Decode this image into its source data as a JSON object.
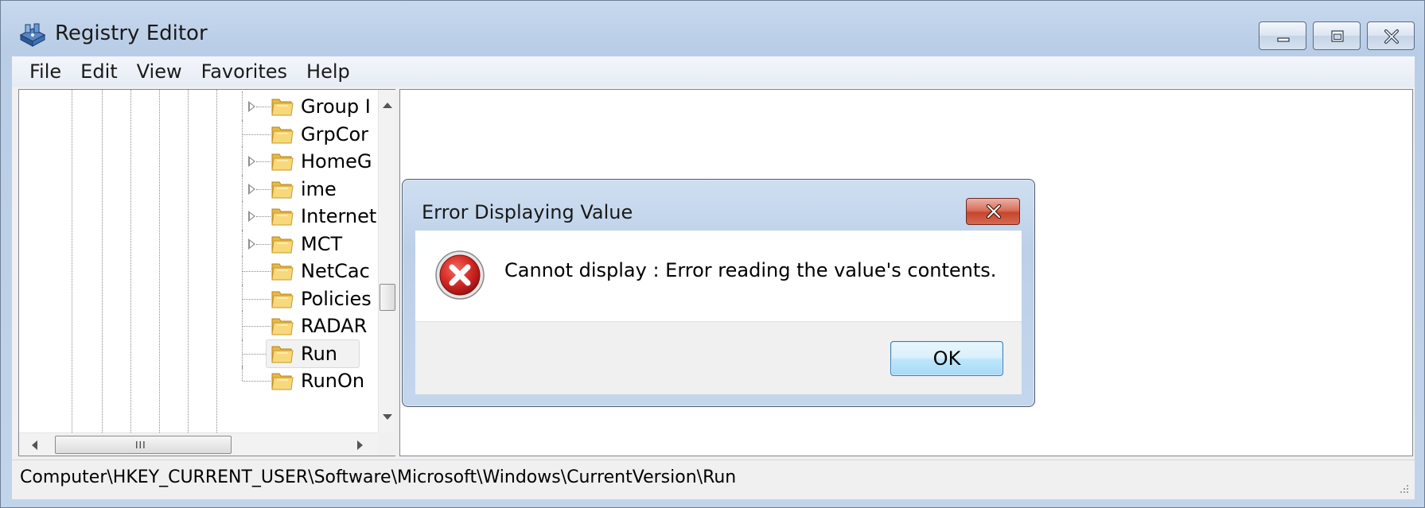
{
  "window": {
    "title": "Registry Editor",
    "icon": "registry-editor-icon",
    "controls": [
      "minimize",
      "maximize",
      "close"
    ]
  },
  "menu": {
    "items": [
      "File",
      "Edit",
      "View",
      "Favorites",
      "Help"
    ]
  },
  "tree": {
    "nodes": [
      {
        "label": "Group I",
        "expandable": true
      },
      {
        "label": "GrpCor",
        "expandable": false
      },
      {
        "label": "HomeG",
        "expandable": true
      },
      {
        "label": "ime",
        "expandable": true
      },
      {
        "label": "Internet",
        "expandable": true
      },
      {
        "label": "MCT",
        "expandable": true
      },
      {
        "label": "NetCac",
        "expandable": false
      },
      {
        "label": "Policies",
        "expandable": false
      },
      {
        "label": "RADAR",
        "expandable": false
      },
      {
        "label": "Run",
        "expandable": false,
        "selected": true
      },
      {
        "label": "RunOn",
        "expandable": false
      }
    ],
    "hscroll_grip": "III"
  },
  "status": {
    "path": "Computer\\HKEY_CURRENT_USER\\Software\\Microsoft\\Windows\\CurrentVersion\\Run"
  },
  "dialog": {
    "title": "Error Displaying Value",
    "message": "Cannot display :  Error reading the value's contents.",
    "ok_label": "OK",
    "icon": "error-icon"
  },
  "colors": {
    "titlebar": "#c2d4ea",
    "close_button": "#c7452c",
    "ok_button": "#bee6fd",
    "error_red": "#c1272d"
  }
}
